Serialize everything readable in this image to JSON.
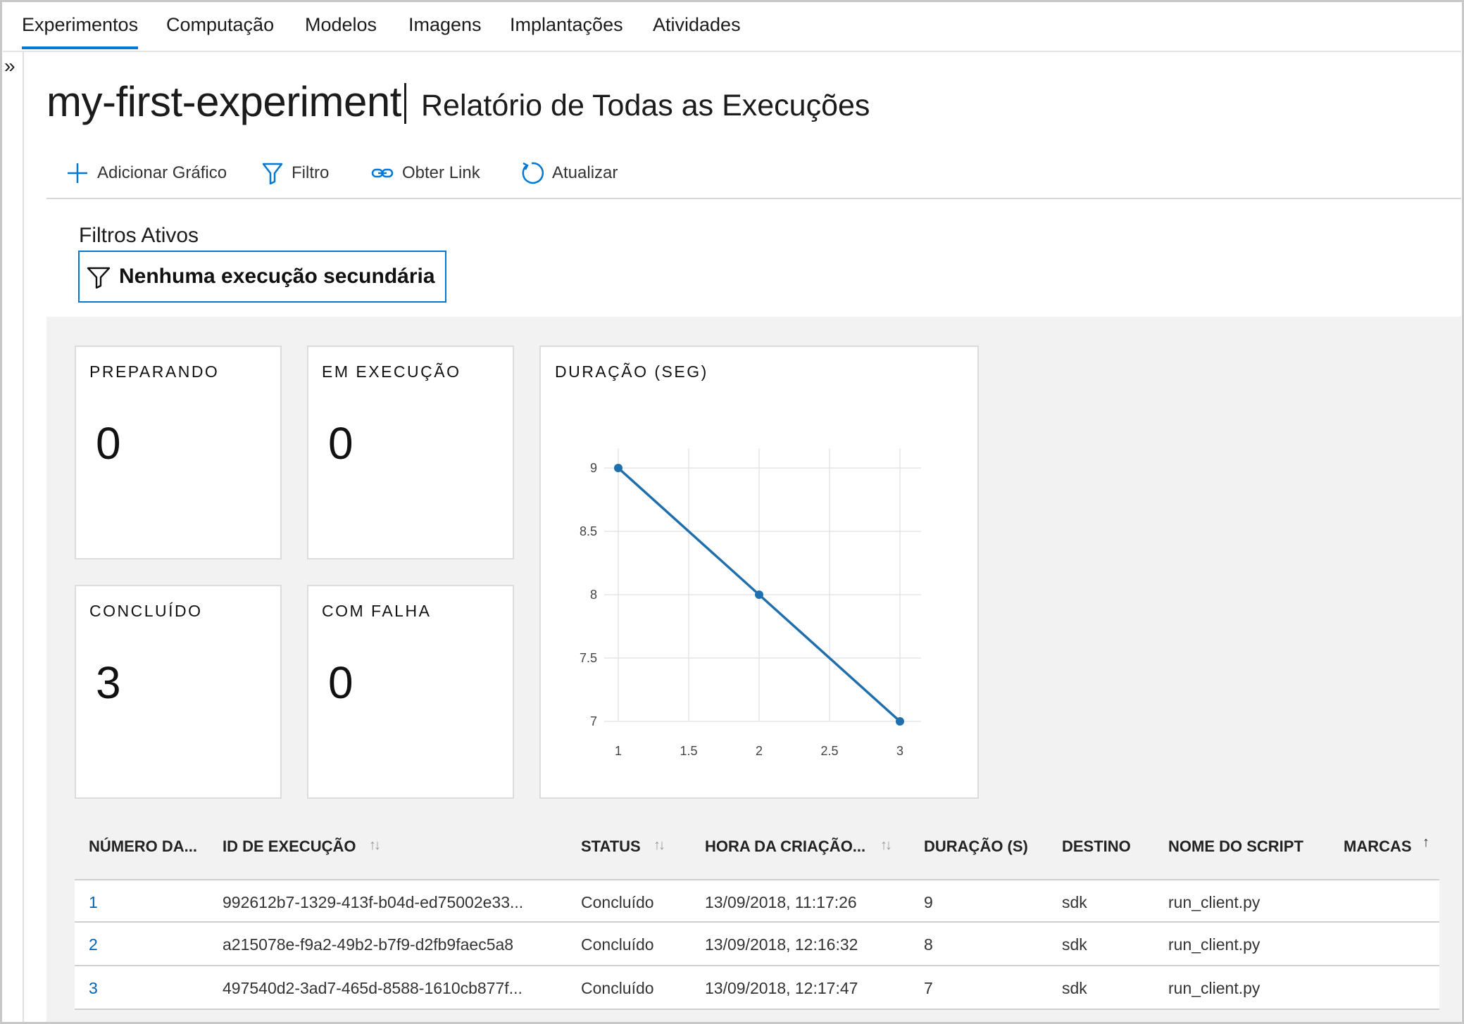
{
  "nav": {
    "tabs": [
      {
        "label": "Experimentos",
        "active": true
      },
      {
        "label": "Computação"
      },
      {
        "label": "Modelos"
      },
      {
        "label": "Imagens"
      },
      {
        "label": "Implantações"
      },
      {
        "label": "Atividades"
      }
    ]
  },
  "rail": {
    "toggle_glyph": "»",
    "toggle_icon": "double-chevron-right-icon"
  },
  "header": {
    "title": "my-first-experiment",
    "subtitle": "Relatório de Todas as Execuções"
  },
  "toolbar": {
    "add_chart": "Adicionar Gráfico",
    "filter": "Filtro",
    "get_link": "Obter Link",
    "refresh": "Atualizar"
  },
  "filters": {
    "title": "Filtros Ativos",
    "chip_label": "Nenhuma execução secundária"
  },
  "cards": {
    "preparing": {
      "title": "PREPARANDO",
      "value": "0"
    },
    "running": {
      "title": "EM EXECUÇÃO",
      "value": "0"
    },
    "completed": {
      "title": "CONCLUÍDO",
      "value": "3"
    },
    "failed": {
      "title": "COM FALHA",
      "value": "0"
    }
  },
  "chart_data": {
    "type": "line",
    "title": "DURAÇÃO (SEG)",
    "x": [
      1,
      2,
      3
    ],
    "series": [
      {
        "values": [
          9,
          8,
          7
        ]
      }
    ],
    "xlim": [
      1,
      3
    ],
    "ylim": [
      7,
      9
    ],
    "x_ticks": [
      "1",
      "1.5",
      "2",
      "2.5",
      "3"
    ],
    "y_ticks": [
      "9",
      "8.5",
      "8",
      "7.5",
      "7"
    ],
    "grid": true,
    "line_color": "#1f6fad"
  },
  "table": {
    "columns": [
      "NÚMERO DA...",
      "ID DE EXECUÇÃO",
      "STATUS",
      "HORA DA CRIAÇÃO...",
      "DURAÇÃO (S)",
      "DESTINO",
      "NOME DO SCRIPT",
      "MARCAS"
    ],
    "sort_glyph": "↑↓",
    "sort_asc_glyph": "↑",
    "rows": [
      {
        "number": "1",
        "run_id": "992612b7-1329-413f-b04d-ed75002e33...",
        "status": "Concluído",
        "created": "13/09/2018, 11:17:26",
        "duration": "9",
        "target": "sdk",
        "script": "run_client.py"
      },
      {
        "number": "2",
        "run_id": "a215078e-f9a2-49b2-b7f9-d2fb9faec5a8",
        "status": "Concluído",
        "created": "13/09/2018, 12:16:32",
        "duration": "8",
        "target": "sdk",
        "script": "run_client.py"
      },
      {
        "number": "3",
        "run_id": "497540d2-3ad7-465d-8588-1610cb877f...",
        "status": "Concluído",
        "created": "13/09/2018, 12:17:47",
        "duration": "7",
        "target": "sdk",
        "script": "run_client.py"
      }
    ]
  },
  "colors": {
    "accent": "#0078d4",
    "link": "#0063b1",
    "dashboard_bg": "#f2f2f2"
  }
}
